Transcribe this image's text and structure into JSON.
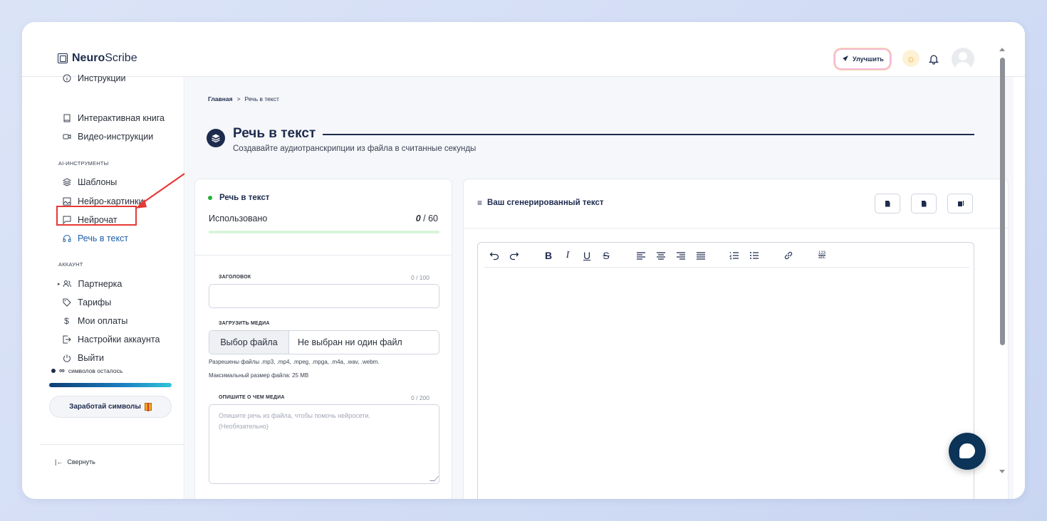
{
  "app": {
    "name_bold": "Neuro",
    "name_rest": "Scribe"
  },
  "header": {
    "upgrade_label": "Улучшить"
  },
  "sidebar": {
    "items_top": [
      {
        "label": "Инструкции",
        "icon": "info-icon"
      },
      {
        "label": "Интерактивная книга",
        "icon": "book-icon"
      },
      {
        "label": "Видео-инструкции",
        "icon": "video-icon"
      }
    ],
    "section_ai": "AI-ИНСТРУМЕНТЫ",
    "items_ai": [
      {
        "label": "Шаблоны",
        "icon": "layers-icon"
      },
      {
        "label": "Нейро-картинки",
        "icon": "image-icon"
      },
      {
        "label": "Нейрочат",
        "icon": "chat-icon"
      },
      {
        "label": "Речь в текст",
        "icon": "headphones-icon",
        "active": true
      }
    ],
    "section_account": "АККАУНТ",
    "items_account": [
      {
        "label": "Партнерка",
        "icon": "users-icon"
      },
      {
        "label": "Тарифы",
        "icon": "tag-icon"
      },
      {
        "label": "Мои оплаты",
        "icon": "dollar-icon"
      },
      {
        "label": "Настройки аккаунта",
        "icon": "login-icon"
      },
      {
        "label": "Выйти",
        "icon": "power-icon"
      }
    ],
    "credits_symbol": "∞",
    "credits_label": "символов осталось",
    "earn_label": "Заработай символы",
    "collapse_label": "Свернуть"
  },
  "breadcrumb": {
    "home": "Главная",
    "separator": ">",
    "current": "Речь в текст"
  },
  "page": {
    "title": "Речь в текст",
    "subtitle": "Создавайте аудиотранскрипции из файла в считанные секунды"
  },
  "left_card": {
    "title": "Речь в текст",
    "used_label": "Использовано",
    "used_value": "0",
    "used_total": "/ 60",
    "title_field": {
      "label": "ЗАГОЛОВОК",
      "count": "0 / 100",
      "value": ""
    },
    "media_field": {
      "label": "ЗАГРУЗИТЬ МЕДИА",
      "button": "Выбор файла",
      "file_text": "Не выбран ни один файл",
      "hint_formats": "Разрешены файлы .mp3, .mp4, .mpeg, .mpga, .m4a, .wav, .webm.",
      "hint_size": "Максимальный размер файла: 25 MB"
    },
    "desc_field": {
      "label": "ОПИШИТЕ О ЧЕМ МЕДИА",
      "count": "0 / 200",
      "placeholder": "Опишите речь из файла, чтобы помочь нейросети. (Необязательно)"
    }
  },
  "right_card": {
    "title": "Ваш сгенерированный текст",
    "toolbar": [
      "undo",
      "redo",
      "bold",
      "italic",
      "underline",
      "strikethrough",
      "align-left",
      "align-center",
      "align-right",
      "align-justify",
      "ordered-list",
      "unordered-list",
      "link",
      "spellcheck"
    ]
  },
  "colors": {
    "brand": "#1d2b4d",
    "active": "#1d5fa8",
    "annotation": "#e53935"
  }
}
